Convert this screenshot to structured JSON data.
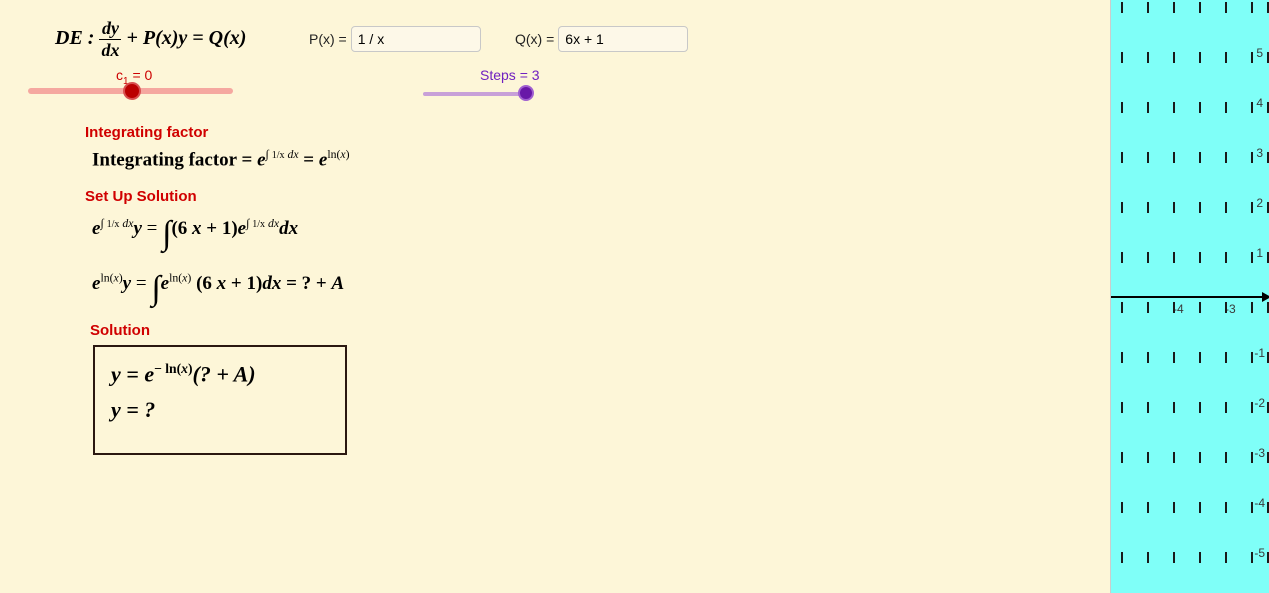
{
  "de_prefix": "DE :",
  "de_frac_num": "dy",
  "de_frac_den": "dx",
  "de_rest": " + P(x)y = Q(x)",
  "px_label": "P(x) =",
  "px_value": "1 / x",
  "qx_label": "Q(x) =",
  "qx_value": "6x + 1",
  "c1_label_pre": "c",
  "c1_label_sub": "1",
  "c1_label_post": " = 0",
  "steps_label": "Steps = 3",
  "head_if": "Integrating factor",
  "line_if": "Integrating factor = e∫(1/x)dx = eln(x)",
  "head_setup": "Set Up Solution",
  "line_setup1_a": "e",
  "line_setup1_b": "y = ",
  "line_setup1_c": "(6 x + 1)e",
  "line_setup1_d": "dx",
  "line_setup2_a": "e",
  "line_setup2_b": "y = ",
  "line_setup2_c": "e",
  "line_setup2_d": " (6 x + 1)dx = ? + A",
  "head_sol": "Solution",
  "sol_line1": "y = e− ln(x)(? + A)",
  "sol_line2": "y = ?",
  "xtick_m4": "-4",
  "xtick_m3": "-3",
  "ytick_5": "5",
  "ytick_4": "4",
  "ytick_3": "3",
  "ytick_2": "2",
  "ytick_1": "1",
  "ytick_m1": "-1",
  "ytick_m2": "-2",
  "ytick_m3": "-3",
  "ytick_m4": "-4",
  "ytick_m5": "-5"
}
